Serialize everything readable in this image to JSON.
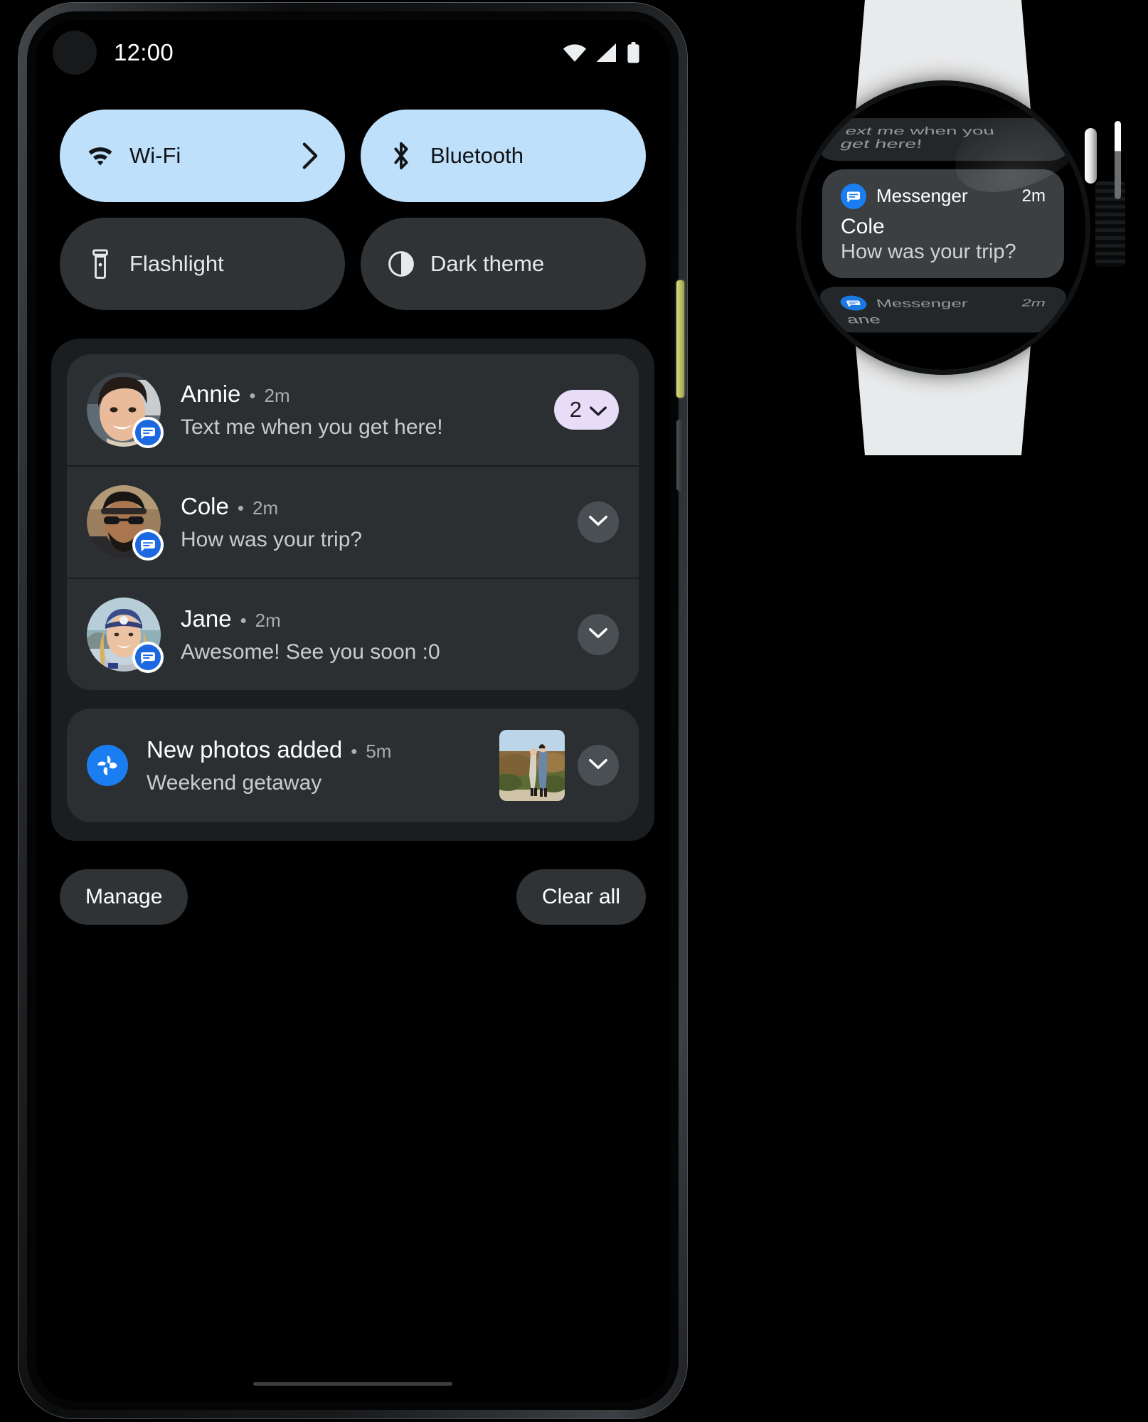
{
  "phone": {
    "status_bar": {
      "clock": "12:00",
      "icons": [
        "wifi-icon",
        "cell-signal-icon",
        "battery-icon"
      ]
    },
    "quick_settings": {
      "tiles": [
        {
          "label": "Wi-Fi",
          "icon": "wifi-icon",
          "state": "on",
          "has_chevron": true
        },
        {
          "label": "Bluetooth",
          "icon": "bluetooth-icon",
          "state": "on",
          "has_chevron": false
        },
        {
          "label": "Flashlight",
          "icon": "flashlight-icon",
          "state": "off",
          "has_chevron": false
        },
        {
          "label": "Dark theme",
          "icon": "contrast-icon",
          "state": "off",
          "has_chevron": false
        }
      ]
    },
    "notifications": {
      "conversations": [
        {
          "sender": "Annie",
          "separator": "•",
          "time": "2m",
          "message": "Text me when you get here!",
          "app": "messenger-icon",
          "badge_count": "2"
        },
        {
          "sender": "Cole",
          "separator": "•",
          "time": "2m",
          "message": "How was your trip?",
          "app": "messenger-icon",
          "badge_count": null
        },
        {
          "sender": "Jane",
          "separator": "•",
          "time": "2m",
          "message": "Awesome! See you soon :0",
          "app": "messenger-icon",
          "badge_count": null
        }
      ],
      "photos": {
        "title": "New photos added",
        "separator": "•",
        "time": "5m",
        "subtitle": "Weekend getaway",
        "app": "google-photos-icon",
        "thumbnail": "couple-hillside-photo"
      },
      "actions": {
        "manage_label": "Manage",
        "clear_all_label": "Clear all"
      }
    }
  },
  "watch": {
    "notifications": {
      "above_partial": {
        "line1": "еxt me when you",
        "line2": "get here!"
      },
      "main": {
        "app_name": "Messenger",
        "time": "2m",
        "title": "Cole",
        "message": "How was your trip?",
        "app": "messenger-icon"
      },
      "below_partial": {
        "app_name": "Messenger",
        "time": "2m",
        "title": "ane",
        "app": "messenger-icon"
      }
    }
  },
  "colors": {
    "tile_on_bg": "#bfe0fb",
    "tile_off_bg": "#2f3336",
    "shade_bg": "#1b1e20",
    "card_bg": "#2b2f32",
    "badge_bg": "#e7ddf6",
    "messenger_blue": "#1b68e0",
    "photos_blue": "#1b7ef0",
    "power_button": "#c3c86a",
    "watch_band": "#e9eaeb"
  }
}
